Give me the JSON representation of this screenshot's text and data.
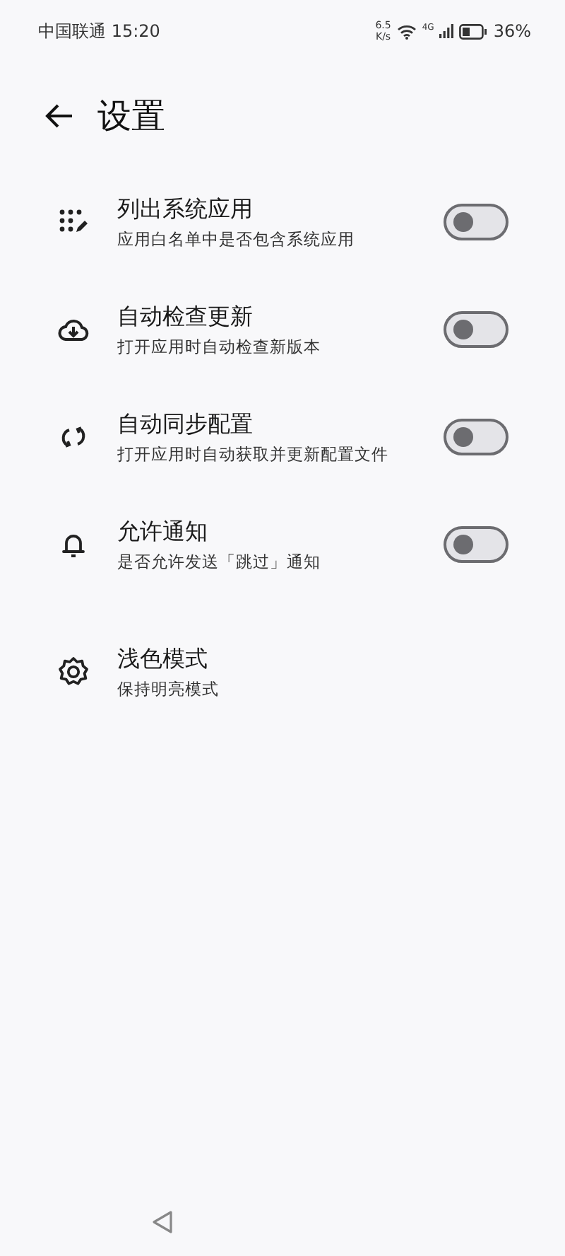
{
  "status_bar": {
    "carrier_time": "中国联通 15:20",
    "net_speed_value": "6.5",
    "net_speed_unit": "K/s",
    "network_type": "4G",
    "battery": "36%"
  },
  "app_bar": {
    "title": "设置"
  },
  "settings": [
    {
      "kind": "toggle",
      "title": "列出系统应用",
      "subtitle": "应用白名单中是否包含系统应用",
      "on": false
    },
    {
      "kind": "toggle",
      "title": "自动检查更新",
      "subtitle": "打开应用时自动检查新版本",
      "on": false
    },
    {
      "kind": "toggle",
      "title": "自动同步配置",
      "subtitle": "打开应用时自动获取并更新配置文件",
      "on": false
    },
    {
      "kind": "toggle",
      "title": "允许通知",
      "subtitle": "是否允许发送「跳过」通知",
      "on": false
    },
    {
      "kind": "plain",
      "title": "浅色模式",
      "subtitle": "保持明亮模式"
    }
  ]
}
